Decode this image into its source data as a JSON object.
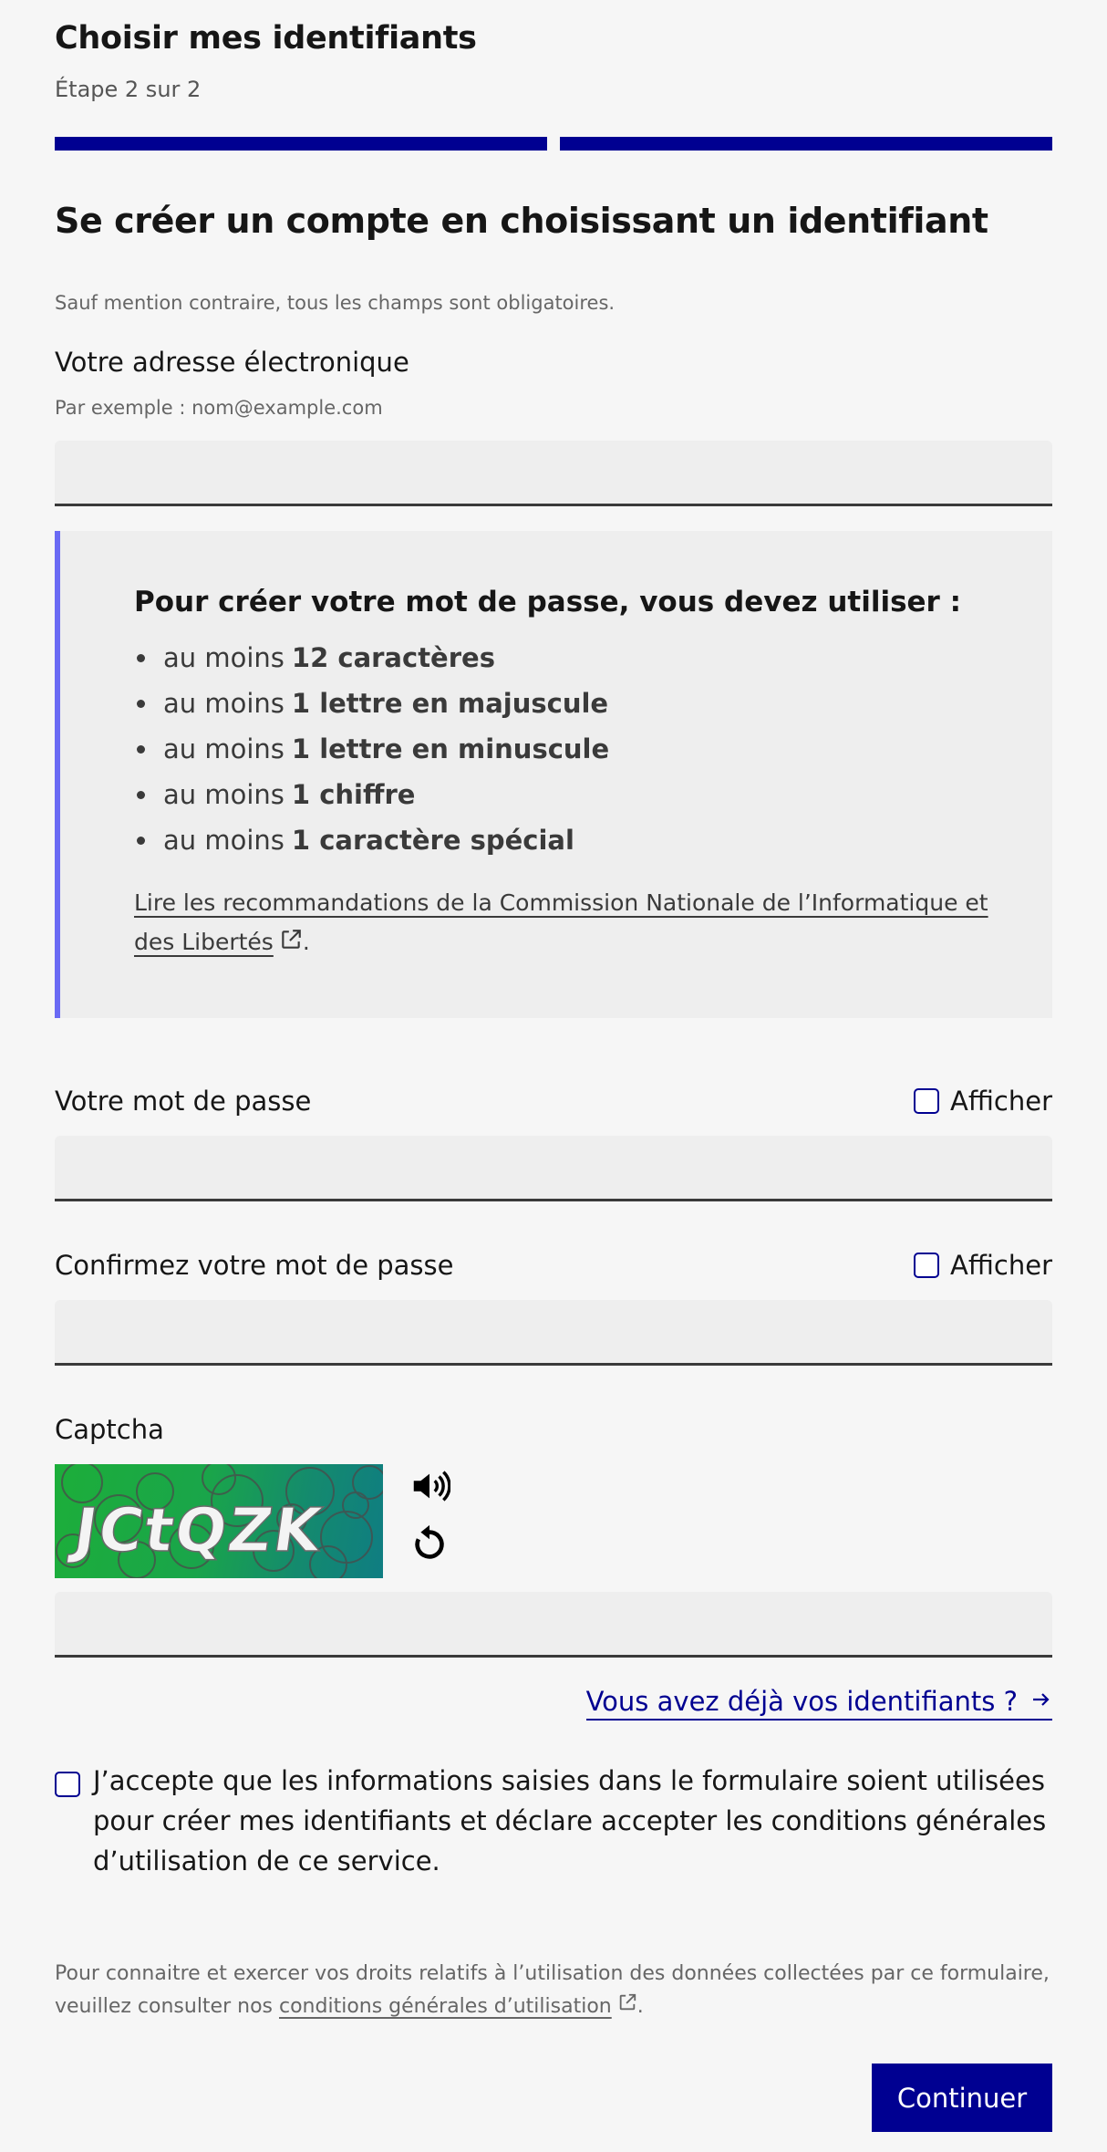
{
  "header": {
    "title": "Choisir mes identifiants",
    "step": "Étape 2 sur 2",
    "progress": {
      "current": 2,
      "total": 2
    }
  },
  "form": {
    "title": "Se créer un compte en choisissant un identifiant",
    "required_hint": "Sauf mention contraire, tous les champs sont obligatoires.",
    "email": {
      "label": "Votre adresse électronique",
      "hint": "Par exemple : nom@example.com",
      "value": ""
    },
    "password_rules": {
      "title": "Pour créer votre mot de passe, vous devez utiliser :",
      "items": [
        {
          "prefix": "au moins",
          "strong": "12 caractères"
        },
        {
          "prefix": "au moins",
          "strong": "1 lettre en majuscule"
        },
        {
          "prefix": "au moins",
          "strong": "1 lettre en minuscule"
        },
        {
          "prefix": "au moins",
          "strong": "1 chiffre"
        },
        {
          "prefix": "au moins",
          "strong": "1 caractère spécial"
        }
      ],
      "link_text": "Lire les recommandations de la Commission Nationale de l’Informatique et des Libertés",
      "link_suffix": "."
    },
    "password": {
      "label": "Votre mot de passe",
      "show_label": "Afficher",
      "value": ""
    },
    "confirm_password": {
      "label": "Confirmez votre mot de passe",
      "show_label": "Afficher",
      "value": ""
    },
    "captcha": {
      "label": "Captcha",
      "image_text": "JCtQZK",
      "value": ""
    },
    "already_link": "Vous avez déjà vos identifiants ?",
    "consent": "J’accepte que les informations saisies dans le formulaire soient utilisées pour créer mes identifiants et déclare accepter les conditions générales d’utilisation de ce service.",
    "legal_text": "Pour connaitre et exercer vos droits relatifs à l’utilisation des données collectées par ce formulaire, veuillez consulter nos",
    "legal_link": "conditions générales d’utilisation",
    "legal_suffix": ".",
    "submit": "Continuer"
  },
  "colors": {
    "primary": "#000091",
    "accent_border": "#6a6af4",
    "background": "#f6f6f6",
    "field_bg": "#eeeeee"
  }
}
